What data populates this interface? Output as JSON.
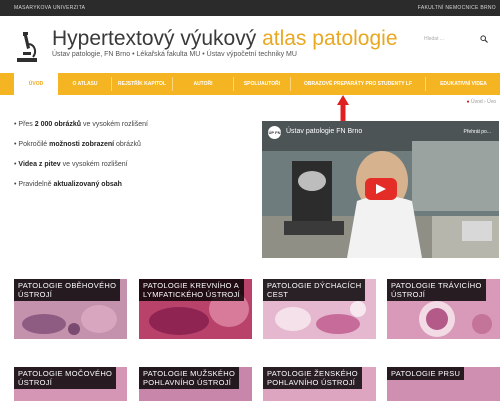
{
  "topstrip": {
    "left": "MASARYKOVA UNIVERZITA",
    "right": "FAKULTNÍ NEMOCNICE BRNO"
  },
  "header": {
    "title_main": "Hypertextový výukový ",
    "title_highlight": "atlas patologie",
    "subtitle": "Ústav patologie, FN Brno • Lékařská fakulta MU • Ústav výpočetní techniky MU",
    "search_placeholder": "Hledat ...",
    "search_icon": "magnifier-icon"
  },
  "nav": {
    "items": [
      {
        "label": "ÚVOD"
      },
      {
        "label": "O ATLASU"
      },
      {
        "label": "REJSTŘÍK KAPITOL"
      },
      {
        "label": "AUTOŘI"
      },
      {
        "label": "SPOLUAUTOŘI"
      },
      {
        "label": "OBRAZOVÉ PREPARÁTY PRO STUDENTY LF"
      },
      {
        "label": "EDUKATIVNÍ VIDEA"
      }
    ],
    "active_color": "#e9a820",
    "bar_color": "#f5b421"
  },
  "breadcrumb": {
    "home": "Úvod",
    "sep": "›",
    "current": "Úvo"
  },
  "features": [
    {
      "pre": "Přes ",
      "bold": "2 000 obrázků",
      "post": " ve vysokém rozlišení"
    },
    {
      "pre": "Pokročilé ",
      "bold": "možnosti zobrazení",
      "post": " obrázků"
    },
    {
      "pre": "",
      "bold": "Videa z pitev",
      "post": " ve vysokém rozlišení"
    },
    {
      "pre": "Pravidelně ",
      "bold": "aktualizovaný obsah",
      "post": ""
    }
  ],
  "video": {
    "channel_logo": "ÚP FN",
    "title": "Ústav patologie FN Brno",
    "watch_later": "Přehrát po...",
    "play_icon": "play-icon"
  },
  "tiles": [
    {
      "label": "PATOLOGIE OBĚHOVÉHO ÚSTROJÍ",
      "line1": "PATOLOGIE OBĚHOVÉHO",
      "line2": "ÚSTROJÍ"
    },
    {
      "label": "PATOLOGIE KREVNÍHO A LYMFATICKÉHO ÚSTROJÍ",
      "line1": "PATOLOGIE KREVNÍHO A",
      "line2": "LYMFATICKÉHO ÚSTROJÍ"
    },
    {
      "label": "PATOLOGIE DÝCHACÍCH CEST",
      "line1": "PATOLOGIE DÝCHACÍCH",
      "line2": "CEST"
    },
    {
      "label": "PATOLOGIE TRÁVICÍHO ÚSTROJÍ",
      "line1": "PATOLOGIE TRÁVICÍHO",
      "line2": "ÚSTROJÍ"
    },
    {
      "label": "PATOLOGIE MOČOVÉHO ÚSTROJÍ",
      "line1": "PATOLOGIE MOČOVÉHO",
      "line2": "ÚSTROJÍ"
    },
    {
      "label": "PATOLOGIE MUŽSKÉHO POHLAVNÍHO ÚSTROJÍ",
      "line1": "PATOLOGIE MUŽSKÉHO",
      "line2": "POHLAVNÍHO ÚSTROJÍ"
    },
    {
      "label": "PATOLOGIE ŽENSKÉHO POHLAVNÍHO ÚSTROJÍ",
      "line1": "PATOLOGIE ŽENSKÉHO",
      "line2": "POHLAVNÍHO ÚSTROJÍ"
    },
    {
      "label": "PATOLOGIE PRSU",
      "line1": "PATOLOGIE PRSU",
      "line2": ""
    }
  ],
  "annotation": {
    "arrow_color": "#e02020",
    "arrow_icon": "red-up-arrow-icon"
  }
}
